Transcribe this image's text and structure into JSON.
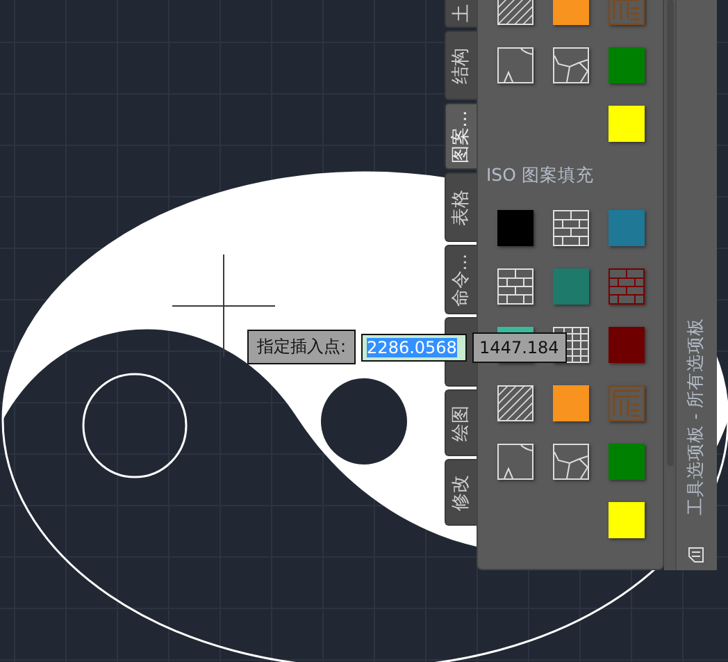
{
  "palette": {
    "title": "工具选项板 - 所有选项板",
    "tabs": [
      {
        "label": "土",
        "selected": false
      },
      {
        "label": "结构",
        "selected": false
      },
      {
        "label": "图案...",
        "selected": true
      },
      {
        "label": "表格",
        "selected": false
      },
      {
        "label": "命令...",
        "selected": false
      },
      {
        "selected": false
      },
      {
        "label": "绘图",
        "selected": false
      },
      {
        "label": "修改",
        "selected": false
      }
    ],
    "sections": [
      {
        "tiles": [
          {
            "kind": "diagonal"
          },
          {
            "kind": "color",
            "color": "#f7931e"
          },
          {
            "kind": "parquet"
          },
          {
            "kind": "sketch-a"
          },
          {
            "kind": "sketch-b"
          },
          {
            "kind": "color",
            "color": "#008000"
          },
          {
            "kind": "empty"
          },
          {
            "kind": "empty"
          },
          {
            "kind": "color",
            "color": "#ffff00"
          }
        ]
      },
      {
        "heading": "ISO 图案填充",
        "tiles": [
          {
            "kind": "color",
            "color": "#000000"
          },
          {
            "kind": "brick",
            "color": "#e0e0e0"
          },
          {
            "kind": "color",
            "color": "#1e7896"
          },
          {
            "kind": "brick",
            "color": "#e0e0e0"
          },
          {
            "kind": "color",
            "color": "#1e7a6a"
          },
          {
            "kind": "brick",
            "color": "#7a0000"
          },
          {
            "kind": "color",
            "color": "#3cb89a"
          },
          {
            "kind": "grid"
          },
          {
            "kind": "color",
            "color": "#6f0000"
          },
          {
            "kind": "diagonal"
          },
          {
            "kind": "color",
            "color": "#f7931e"
          },
          {
            "kind": "parquet"
          },
          {
            "kind": "sketch-a"
          },
          {
            "kind": "sketch-b"
          },
          {
            "kind": "color",
            "color": "#008000"
          },
          {
            "kind": "empty"
          },
          {
            "kind": "empty"
          },
          {
            "kind": "color",
            "color": "#ffff00"
          }
        ]
      }
    ]
  },
  "prompt": {
    "label": "指定插入点:",
    "x_value": "2286.0568",
    "y_value": "1447.184"
  }
}
